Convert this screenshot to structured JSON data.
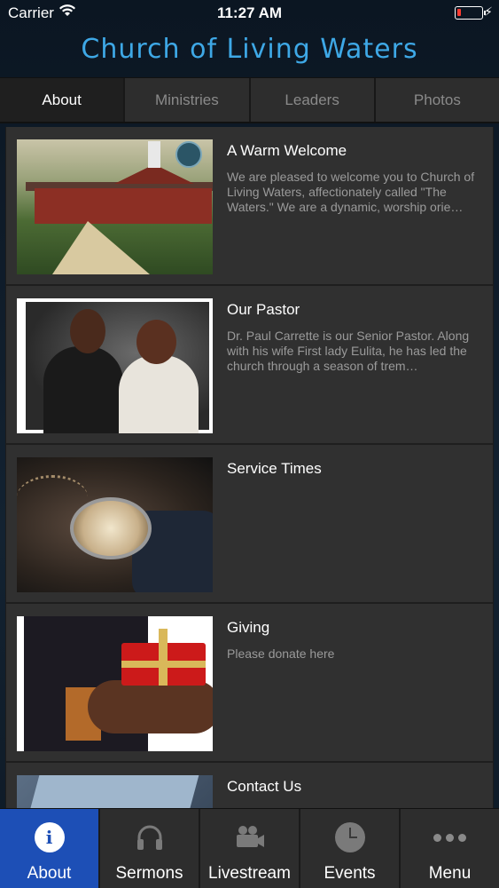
{
  "status_bar": {
    "carrier": "Carrier",
    "time": "11:27 AM",
    "battery_color": "#ff3b30",
    "battery_level": 0.15
  },
  "header": {
    "title": "Church of Living Waters",
    "title_color": "#3ea8e6"
  },
  "tabs": [
    {
      "label": "About",
      "active": true
    },
    {
      "label": "Ministries",
      "active": false
    },
    {
      "label": "Leaders",
      "active": false
    },
    {
      "label": "Photos",
      "active": false
    }
  ],
  "items": [
    {
      "title": "A Warm Welcome",
      "description": "We are pleased to welcome you to Church of Living Waters, affectionately called \"The Waters.\" We are a dynamic, worship orie…"
    },
    {
      "title": "Our Pastor",
      "description": "Dr. Paul Carrette is our Senior Pastor. Along with his wife First lady Eulita, he has led the church through a season of trem…"
    },
    {
      "title": "Service Times",
      "description": ""
    },
    {
      "title": "Giving",
      "description": "Please donate here"
    },
    {
      "title": "Contact Us",
      "description": ""
    }
  ],
  "bottom_nav": [
    {
      "label": "About",
      "icon": "info-icon",
      "active": true
    },
    {
      "label": "Sermons",
      "icon": "headphones-icon",
      "active": false
    },
    {
      "label": "Livestream",
      "icon": "video-camera-icon",
      "active": false
    },
    {
      "label": "Events",
      "icon": "clock-icon",
      "active": false
    },
    {
      "label": "Menu",
      "icon": "more-dots-icon",
      "active": false
    }
  ],
  "colors": {
    "accent": "#1d4fb6",
    "background": "#0e1a26",
    "panel": "#303030"
  }
}
